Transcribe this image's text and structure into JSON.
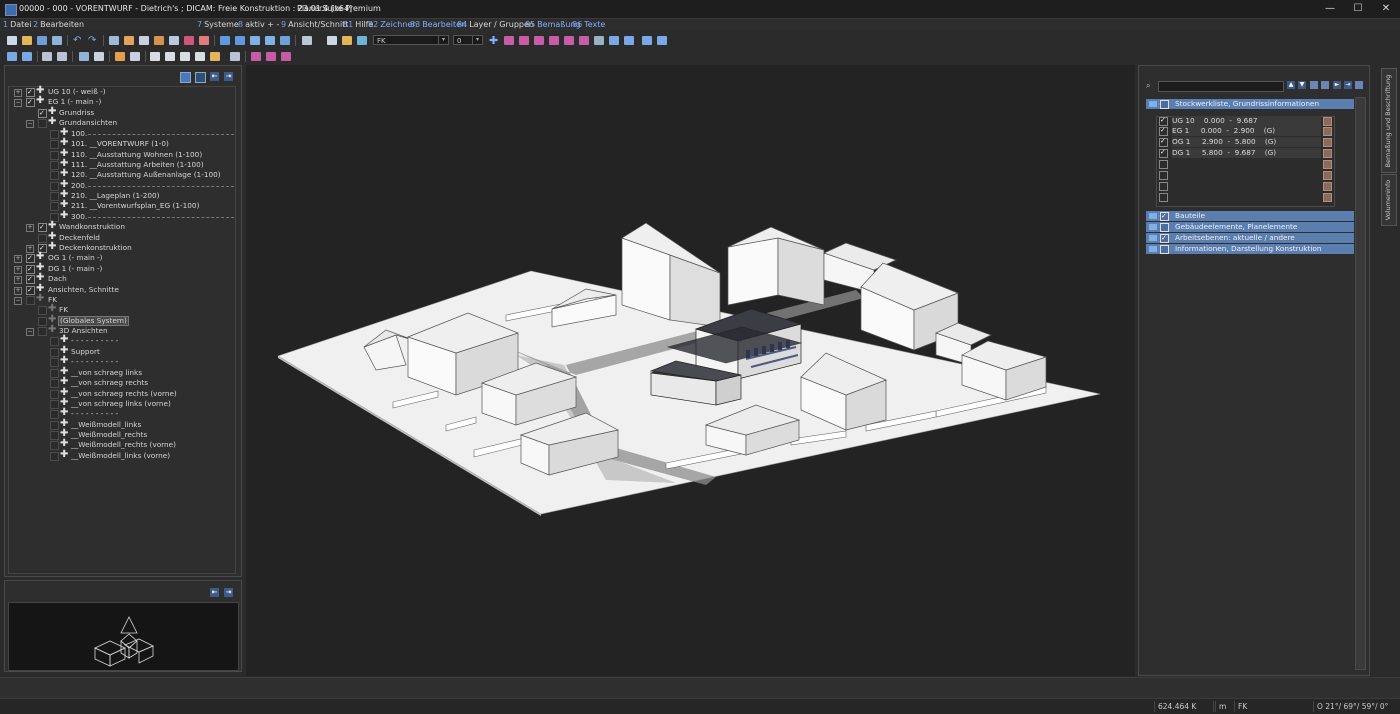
{
  "window": {
    "title": "00000 - 000 - VORENTWURF - Dietrich's ; DICAM: Freie Konstruktion : 23.01.4 [x64]",
    "product": "PlanerSuite Premium",
    "controls": {
      "minimize": "—",
      "maximize": "☐",
      "close": "✕"
    }
  },
  "menu": [
    {
      "num": "1",
      "label": "Datei"
    },
    {
      "num": "2",
      "label": "Bearbeiten"
    },
    {
      "num": "7",
      "label": "Systeme"
    },
    {
      "num": "8",
      "label": "aktiv + -"
    },
    {
      "num": "9",
      "label": "Ansicht/Schnitt"
    },
    {
      "num": "81",
      "label": "Hilfe"
    },
    {
      "num": "82",
      "label": "Zeichnen"
    },
    {
      "num": "83",
      "label": "Bearbeiten"
    },
    {
      "num": "84",
      "label": "Layer / Gruppen"
    },
    {
      "num": "85",
      "label": "Bemaßung"
    },
    {
      "num": "86",
      "label": "Texte"
    }
  ],
  "toolbar": {
    "layer_combo": "FK",
    "number_combo": "0"
  },
  "tree": [
    {
      "label": "UG 10 (- weiß -)"
    },
    {
      "label": "EG 1 (- main -)"
    },
    {
      "label": "Grundriss"
    },
    {
      "label": "Grundansichten"
    },
    {
      "label": "100."
    },
    {
      "label": "101. __VORENTWURF (1-0)"
    },
    {
      "label": "110. __Ausstattung Wohnen (1-100)"
    },
    {
      "label": "111. __Ausstattung Arbeiten (1-100)"
    },
    {
      "label": "120. __Ausstattung Außenanlage (1-100)"
    },
    {
      "label": "200."
    },
    {
      "label": "210. __Lageplan (1-200)"
    },
    {
      "label": "211. __Vorentwurfsplan_EG (1-100)"
    },
    {
      "label": "300."
    },
    {
      "label": "Wandkonstruktion"
    },
    {
      "label": "Deckenfeld"
    },
    {
      "label": "Deckenkonstruktion"
    },
    {
      "label": "OG 1 (- main -)"
    },
    {
      "label": "DG 1 (- main -)"
    },
    {
      "label": "Dach"
    },
    {
      "label": "Ansichten, Schnitte"
    },
    {
      "label": "FK"
    },
    {
      "label": "FK"
    },
    {
      "label": "(Globales System)"
    },
    {
      "label": "3D Ansichten"
    },
    {
      "label": "- - - - - - - - - -"
    },
    {
      "label": "Support"
    },
    {
      "label": "- - - - - - - - - -"
    },
    {
      "label": "__von schraeg links"
    },
    {
      "label": "__von schraeg rechts"
    },
    {
      "label": "__von schraeg rechts (vorne)"
    },
    {
      "label": "__von schraeg links (vorne)"
    },
    {
      "label": "- - - - - - - - - -"
    },
    {
      "label": "__Weißmodell_links"
    },
    {
      "label": "__Weißmodell_rechts"
    },
    {
      "label": "__Weißmodell_rechts (vorne)"
    },
    {
      "label": "__Weißmodell_links (vorne)"
    }
  ],
  "right": {
    "header": "Stockwerkliste, Grundrissinformationen",
    "storeys": [
      {
        "text": "UG 10    0.000  -  9.687"
      },
      {
        "text": "EG 1     0.000  -  2.900    (G)"
      },
      {
        "text": "OG 1     2.900  -  5.800    (G)"
      },
      {
        "text": "DG 1     5.800  -  9.687    (G)"
      }
    ],
    "sections": [
      {
        "label": "Bauteile"
      },
      {
        "label": "Gebäudeelemente, Planelemente"
      },
      {
        "label": "Arbeitsebenen: aktuelle / andere"
      },
      {
        "label": "Informationen, Darstellung Konstruktion"
      }
    ],
    "vtabs": [
      "Bemaßung und Beschriftung",
      "Volumeninfo"
    ]
  },
  "status": {
    "coord": "624.464 K",
    "unit": "m",
    "layer": "FK",
    "angles": "O 21°/ 69°/ 59°/   0°"
  },
  "colors": {
    "accent": "#5a7fae",
    "menu_number": "#7aa0e0"
  }
}
